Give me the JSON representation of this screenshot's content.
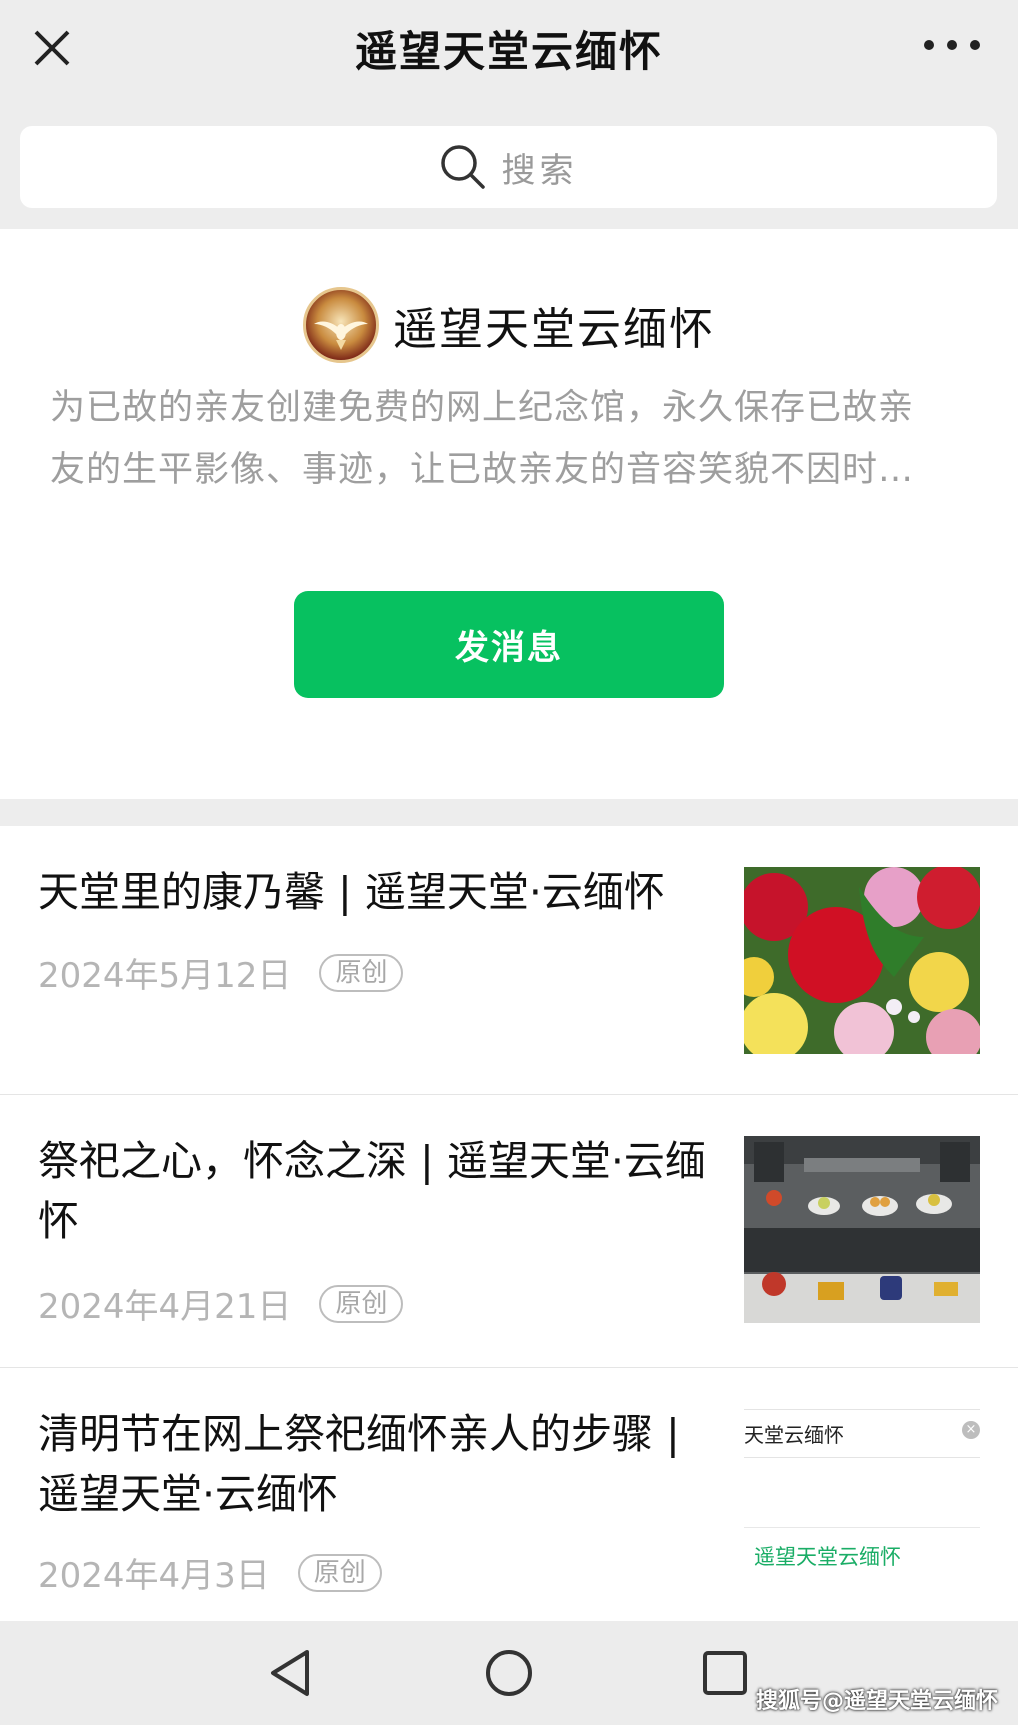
{
  "header": {
    "title": "遥望天堂云缅怀"
  },
  "search": {
    "placeholder": "搜索"
  },
  "account": {
    "name": "遥望天堂云缅怀",
    "description_line1": "为已故的亲友创建免费的网上纪念馆，永久保存已故亲",
    "description_line2": "友的生平影像、事迹，让已故亲友的音容笑貌不因时…",
    "send_button": "发消息"
  },
  "articles": [
    {
      "title": "天堂里的康乃馨 | 遥望天堂·云缅怀",
      "date": "2024年5月12日",
      "badge": "原创",
      "thumb_icon": "carnation-flowers-image"
    },
    {
      "title": "祭祀之心，怀念之深 | 遥望天堂·云缅怀",
      "date": "2024年4月21日",
      "badge": "原创",
      "thumb_icon": "memorial-offerings-image"
    },
    {
      "title": "清明节在网上祭祀缅怀亲人的步骤 | 遥望天堂·云缅怀",
      "date": "2024年4月3日",
      "badge": "原创",
      "thumb_icon": "search-screenshot-image",
      "thumb_text_top": "天堂云缅怀",
      "thumb_text_link": "遥望天堂云缅怀"
    }
  ],
  "watermark": "搜狐号@遥望天堂云缅怀",
  "colors": {
    "accent": "#07c160",
    "background": "#ededed"
  }
}
